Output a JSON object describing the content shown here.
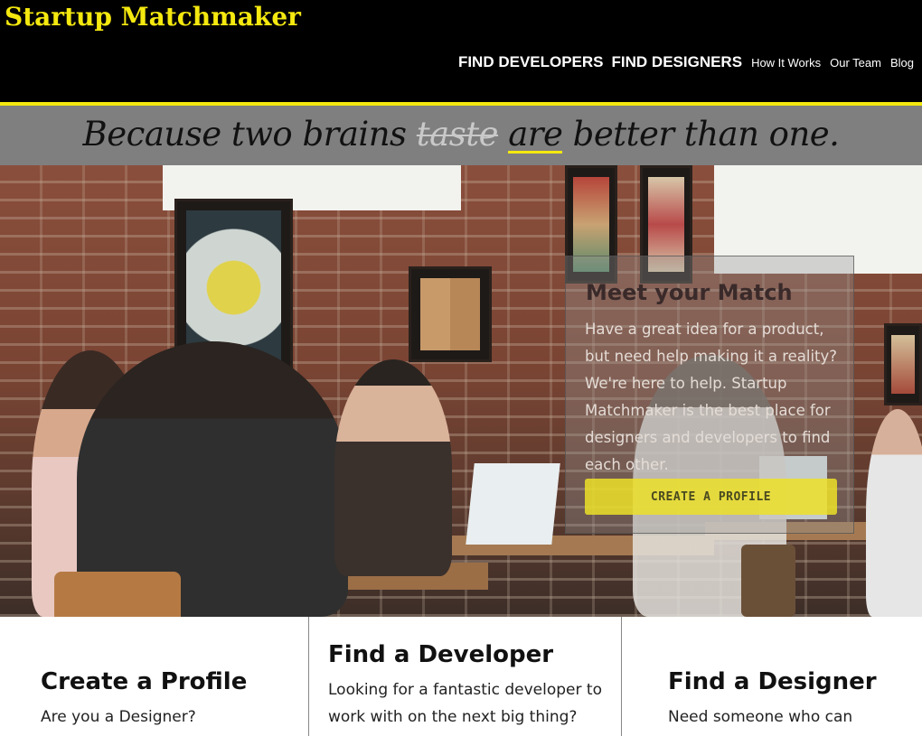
{
  "header": {
    "logo": "Startup Matchmaker",
    "nav": [
      {
        "label": "FIND DEVELOPERS",
        "style": "big"
      },
      {
        "label": "FIND DESIGNERS",
        "style": "big"
      },
      {
        "label": "How It Works",
        "style": "small"
      },
      {
        "label": "Our Team",
        "style": "small"
      },
      {
        "label": "Blog",
        "style": "small"
      }
    ]
  },
  "tagline": {
    "part1": "Because two brains ",
    "struck": "taste",
    "underlined": "are",
    "part2": " better than one."
  },
  "hero_card": {
    "title": "Meet your Match",
    "body": "Have a great idea for a product, but need help making it a reality? We're here to help. Startup Matchmaker is the best place for designers and developers to find each other.",
    "cta": "CREATE A PROFILE"
  },
  "columns": [
    {
      "title": "Create a Profile",
      "text": "Are you a Designer?"
    },
    {
      "title": "Find a Developer",
      "text": "Looking for a fantastic developer to work with on the next big thing?"
    },
    {
      "title": "Find a Designer",
      "text": "Need someone who can"
    }
  ],
  "colors": {
    "brand_yellow": "#f4e80f",
    "header_bg": "#000000",
    "tagband_bg": "#7f7f7f"
  }
}
